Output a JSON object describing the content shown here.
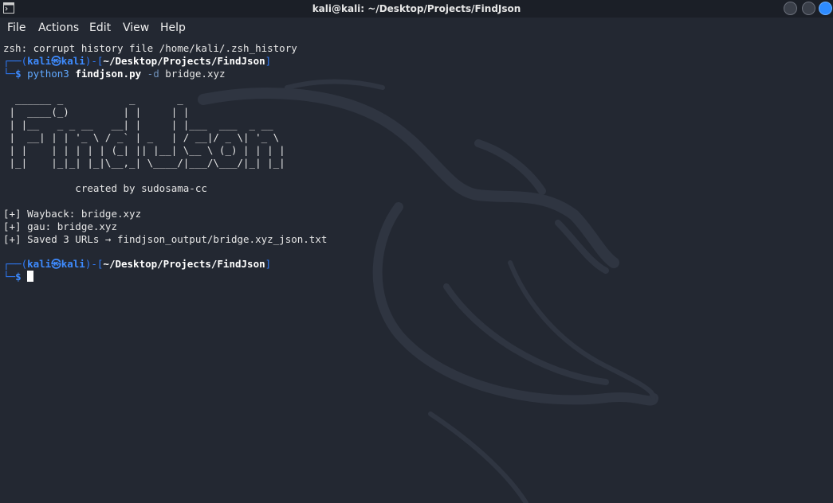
{
  "window": {
    "title": "kali@kali: ~/Desktop/Projects/FindJson"
  },
  "menu": {
    "items": [
      "File",
      "Actions",
      "Edit",
      "View",
      "Help"
    ]
  },
  "terminal": {
    "warning": "zsh: corrupt history file /home/kali/.zsh_history",
    "prompt1": {
      "top_start": "┌──(",
      "user": "kali",
      "at": "㉿",
      "host": "kali",
      "mid": ")-[",
      "path": "~/Desktop/Projects/FindJson",
      "end": "]",
      "bottom": "└─",
      "dollar": "$",
      "cmd_python": "python3",
      "cmd_script": "findjson.py",
      "cmd_flag": "-d",
      "cmd_arg": "bridge.xyz"
    },
    "banner": [
      "  ______ _           _       _                ",
      " |  ____(_)         | |     | |               ",
      " | |__   _ _ __   __| |     | |___  ___  _ __  ",
      " |  __| | | '_ \\ / _` | _   | / __|/ _ \\| '_ \\ ",
      " | |    | | | | | (_| || |__| \\__ \\ (_) | | | |",
      " |_|    |_|_| |_|\\__,_| \\____/|___/\\___/|_| |_|"
    ],
    "credit": "            created by sudosama-cc",
    "output": [
      "[+] Wayback: bridge.xyz",
      "[+] gau: bridge.xyz",
      "[+] Saved 3 URLs → findjson_output/bridge.xyz_json.txt"
    ],
    "prompt2": {
      "top_start": "┌──(",
      "user": "kali",
      "at": "㉿",
      "host": "kali",
      "mid": ")-[",
      "path": "~/Desktop/Projects/FindJson",
      "end": "]",
      "bottom": "└─",
      "dollar": "$"
    }
  },
  "colors": {
    "background": "#232832",
    "prompt_blue": "#2f7dff",
    "accent_close": "#2e8bff"
  }
}
